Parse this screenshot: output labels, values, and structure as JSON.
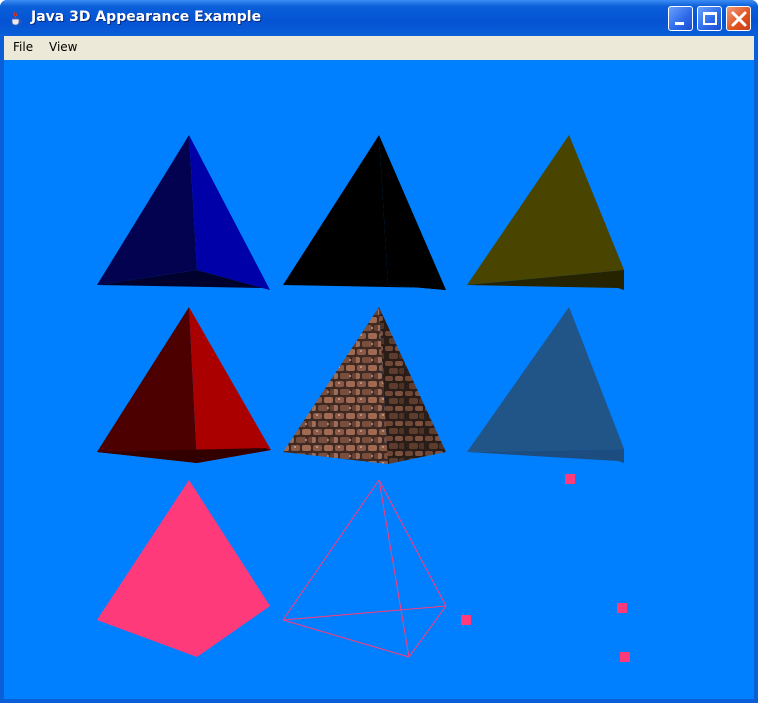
{
  "window": {
    "title": "Java 3D Appearance Example",
    "icon": "java-cup-icon"
  },
  "menubar": {
    "items": [
      {
        "label": "File"
      },
      {
        "label": "View"
      }
    ]
  },
  "scene": {
    "background_color": "#0080ff",
    "objects": [
      {
        "name": "pyramid-blue",
        "style": "shaded",
        "colors": [
          "#020251",
          "#0000a8",
          "#01012e"
        ]
      },
      {
        "name": "pyramid-black",
        "style": "shaded",
        "colors": [
          "#000000",
          "#000000",
          "#000000"
        ]
      },
      {
        "name": "pyramid-olive",
        "style": "shaded",
        "colors": [
          "#494500",
          "#494500",
          "#262300"
        ]
      },
      {
        "name": "pyramid-red",
        "style": "shaded",
        "colors": [
          "#4c0000",
          "#aa0000",
          "#330000"
        ]
      },
      {
        "name": "pyramid-textured",
        "style": "texture",
        "colors": [
          "#7a5040",
          "#5a3a2e",
          "#3a2a22"
        ]
      },
      {
        "name": "pyramid-steel-blue",
        "style": "shaded",
        "colors": [
          "#215588",
          "#215588",
          "#1d4d80"
        ]
      },
      {
        "name": "pyramid-pink",
        "style": "flat",
        "colors": [
          "#ff3a7a"
        ]
      },
      {
        "name": "pyramid-wireframe",
        "style": "wireframe",
        "colors": [
          "#ff3a7a"
        ]
      },
      {
        "name": "pyramid-points",
        "style": "points",
        "colors": [
          "#ff3a7a"
        ]
      }
    ]
  }
}
